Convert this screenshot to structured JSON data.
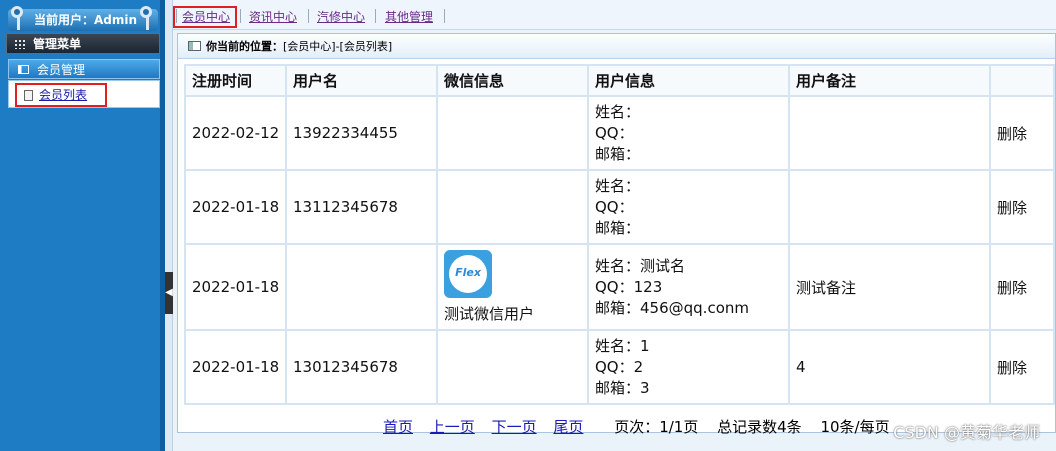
{
  "sidebar": {
    "current_user": "当前用户：Admin",
    "menu_title": "管理菜单",
    "section_title": "会员管理",
    "items": [
      {
        "label": "会员列表"
      }
    ]
  },
  "splitter": {
    "arrow": "◀"
  },
  "tabs": [
    {
      "label": "会员中心",
      "active": true
    },
    {
      "label": "资讯中心"
    },
    {
      "label": "汽修中心"
    },
    {
      "label": "其他管理"
    }
  ],
  "breadcrumb": {
    "prefix": "你当前的位置：",
    "path": "[会员中心]-[会员列表]"
  },
  "table": {
    "headers": [
      "注册时间",
      "用户名",
      "微信信息",
      "用户信息",
      "用户备注",
      ""
    ],
    "rows": [
      {
        "date": "2022-02-12",
        "username": "13922334455",
        "wechat_name": "",
        "info": [
          "姓名：",
          "QQ：",
          "邮箱："
        ],
        "remark": "",
        "action": "删除"
      },
      {
        "date": "2022-01-18",
        "username": "13112345678",
        "wechat_name": "",
        "info": [
          "姓名：",
          "QQ：",
          "邮箱："
        ],
        "remark": "",
        "action": "删除"
      },
      {
        "date": "2022-01-18",
        "username": "",
        "wechat_name": "测试微信用户",
        "avatar_text": "Flex",
        "info": [
          "姓名：测试名",
          "QQ：123",
          "邮箱：456@qq.conm"
        ],
        "remark": "测试备注",
        "action": "删除"
      },
      {
        "date": "2022-01-18",
        "username": "13012345678",
        "wechat_name": "",
        "info": [
          "姓名：1",
          "QQ：2",
          "邮箱：3"
        ],
        "remark": "4",
        "action": "删除"
      }
    ]
  },
  "pager": {
    "first": "首页",
    "prev": "上一页",
    "next": "下一页",
    "last": "尾页",
    "page": "页次：1/1页",
    "total": "总记录数4条",
    "per_page": "10条/每页"
  },
  "watermark": "CSDN @黄菊华老师"
}
